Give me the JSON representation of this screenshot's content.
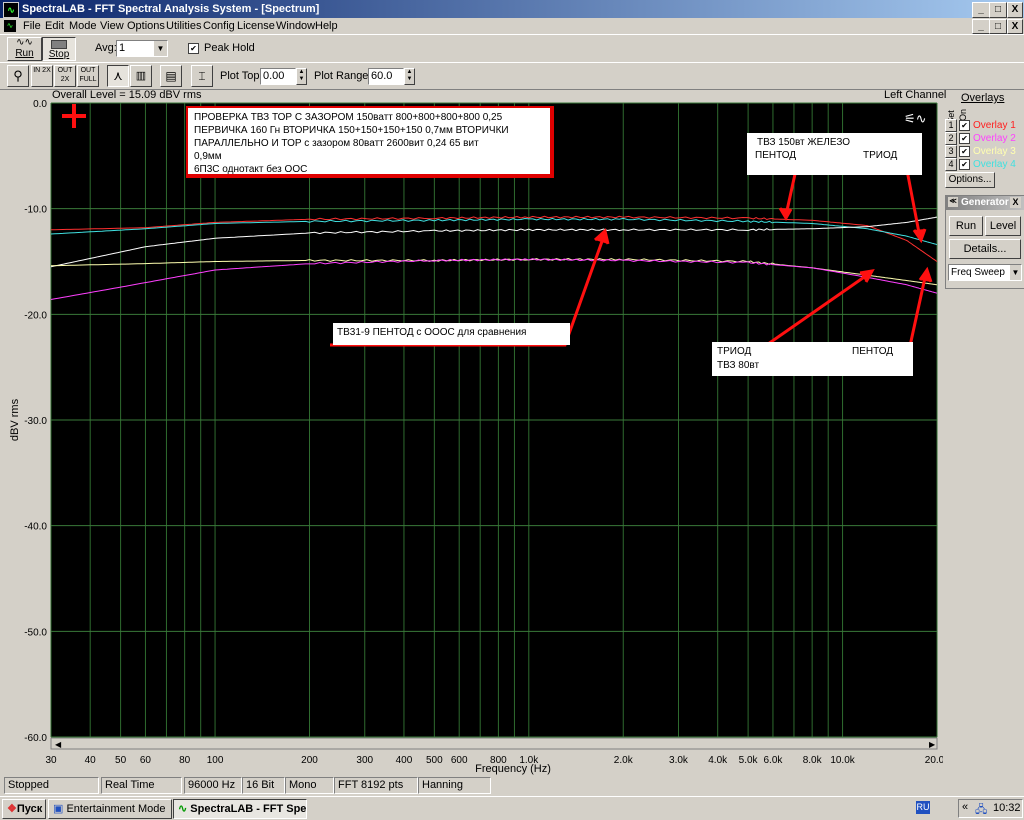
{
  "window": {
    "title": "SpectraLAB - FFT Spectral Analysis System - [Spectrum]",
    "app_icon": "spectrum-icon",
    "minimize": "_",
    "maximize": "□",
    "close": "X"
  },
  "menu": [
    "File",
    "Edit",
    "Mode",
    "View",
    "Options",
    "Utilities",
    "Config",
    "License",
    "Window",
    "Help"
  ],
  "toolbar": {
    "run_label": "Run",
    "stop_label": "Stop",
    "avg_label": "Avg:",
    "avg_value": "1",
    "peak_hold_label": "Peak Hold",
    "peak_hold_checked": true,
    "plot_top_label": "Plot Top:",
    "plot_top_value": "0.00",
    "plot_range_label": "Plot Range:",
    "plot_range_value": "60.0",
    "btn_in_2x": "IN 2X",
    "btn_out_2x": "OUT 2X",
    "btn_out_full": "OUT FULL"
  },
  "plot": {
    "overall_level": "Overall Level = 15.09 dBV rms",
    "channel": "Left Channel",
    "ylabel": "dBV rms",
    "xlabel": "Frequency (Hz)"
  },
  "annotations": {
    "box1": [
      "ПРОВЕРКА  ТВЗ  ТОР  С  ЗАЗОРОМ  150ватт  800+800+800+800  0,25",
      " ПЕРВИЧКА 160 Гн ВТОРИЧКА  150+150+150+150  0,7мм   ВТОРИЧКИ",
      "ПАРАЛЛЕЛЬНО       И  ТОР с       зазором  80ватт   2600вит 0,24  65  вит",
      "0,9мм",
      "6П3С  однотакт  без ООС"
    ],
    "box2_title": "ТВЗ 150вт  ЖЕЛЕЗО",
    "box2_pentode": "ПЕНТОД",
    "box2_triode": "ТРИОД",
    "box3": "ТВ31-9  ПЕНТОД  с  ОООС  для  сравнения",
    "box4_triode": "ТРИОД",
    "box4_pentode": "ПЕНТОД",
    "box4_sub": "ТВЗ 80вт"
  },
  "overlays": {
    "title": "Overlays",
    "set_label": "Set",
    "on_label": "On",
    "items": [
      {
        "num": "1",
        "label": "Overlay 1",
        "color": "#ff2020",
        "checked": true
      },
      {
        "num": "2",
        "label": "Overlay 2",
        "color": "#ff40ff",
        "checked": true
      },
      {
        "num": "3",
        "label": "Overlay 3",
        "color": "#ffffb0",
        "checked": true
      },
      {
        "num": "4",
        "label": "Overlay 4",
        "color": "#40e0e0",
        "checked": true
      }
    ],
    "options_label": "Options..."
  },
  "generator": {
    "title": "Generator",
    "run_label": "Run",
    "level_label": "Level",
    "details_label": "Details...",
    "mode_value": "Freq Sweep"
  },
  "status": [
    "Stopped",
    "Real Time",
    "96000 Hz",
    "16 Bit",
    "Mono",
    "FFT 8192 pts",
    "Hanning"
  ],
  "taskbar": {
    "start_label": "Пуск",
    "tasks": [
      "Entertainment Mode",
      "SpectraLAB - FFT Spe..."
    ],
    "lang": "RU",
    "clock": "10:32"
  },
  "chart_data": {
    "type": "line",
    "xscale": "log",
    "xlim": [
      30,
      20000
    ],
    "ylim": [
      -60,
      0
    ],
    "y_ticks": [
      "0.0",
      "-10.0",
      "-20.0",
      "-30.0",
      "-40.0",
      "-50.0",
      "-60.0"
    ],
    "x_ticks": [
      {
        "v": 30,
        "t": "30"
      },
      {
        "v": 40,
        "t": "40"
      },
      {
        "v": 50,
        "t": "50"
      },
      {
        "v": 60,
        "t": "60"
      },
      {
        "v": 80,
        "t": "80"
      },
      {
        "v": 100,
        "t": "100"
      },
      {
        "v": 200,
        "t": "200"
      },
      {
        "v": 300,
        "t": "300"
      },
      {
        "v": 400,
        "t": "400"
      },
      {
        "v": 500,
        "t": "500"
      },
      {
        "v": 600,
        "t": "600"
      },
      {
        "v": 800,
        "t": "800"
      },
      {
        "v": 1000,
        "t": "1.0k"
      },
      {
        "v": 2000,
        "t": "2.0k"
      },
      {
        "v": 3000,
        "t": "3.0k"
      },
      {
        "v": 4000,
        "t": "4.0k"
      },
      {
        "v": 5000,
        "t": "5.0k"
      },
      {
        "v": 6000,
        "t": "6.0k"
      },
      {
        "v": 8000,
        "t": "8.0k"
      },
      {
        "v": 10000,
        "t": "10.0k"
      },
      {
        "v": 20000,
        "t": "20.0k"
      }
    ],
    "grid": true,
    "series": [
      {
        "color": "#ff3030",
        "x": [
          30,
          60,
          100,
          200,
          500,
          1000,
          2000,
          5000,
          8000,
          12000,
          16000,
          20000
        ],
        "y": [
          -12.0,
          -11.8,
          -11.3,
          -11.0,
          -10.9,
          -10.8,
          -10.8,
          -10.9,
          -11.1,
          -11.6,
          -13.0,
          -15.0
        ]
      },
      {
        "color": "#40e0e0",
        "x": [
          30,
          60,
          100,
          200,
          500,
          1000,
          2000,
          5000,
          8000,
          12000,
          16000,
          20000
        ],
        "y": [
          -12.4,
          -11.9,
          -11.4,
          -11.2,
          -11.1,
          -11.0,
          -11.0,
          -11.2,
          -11.4,
          -11.9,
          -12.6,
          -13.4
        ]
      },
      {
        "color": "#ffffff",
        "x": [
          30,
          60,
          100,
          200,
          500,
          1000,
          2000,
          5000,
          8000,
          12000,
          16000,
          20000
        ],
        "y": [
          -15.5,
          -13.6,
          -12.8,
          -12.3,
          -12.1,
          -12.0,
          -12.0,
          -12.0,
          -11.9,
          -11.7,
          -11.3,
          -10.8
        ]
      },
      {
        "color": "#ffffb0",
        "x": [
          30,
          60,
          100,
          200,
          500,
          1000,
          2000,
          5000,
          8000,
          12000,
          16000,
          20000
        ],
        "y": [
          -15.4,
          -15.2,
          -15.0,
          -14.9,
          -14.9,
          -14.8,
          -14.8,
          -15.0,
          -15.6,
          -16.3,
          -16.8,
          -17.2
        ]
      },
      {
        "color": "#ff40ff",
        "x": [
          30,
          60,
          100,
          200,
          500,
          1000,
          2000,
          5000,
          8000,
          12000,
          16000,
          20000
        ],
        "y": [
          -18.6,
          -17.0,
          -15.8,
          -15.2,
          -14.9,
          -14.8,
          -14.9,
          -15.1,
          -15.6,
          -16.5,
          -17.2,
          -18.0
        ]
      }
    ]
  }
}
